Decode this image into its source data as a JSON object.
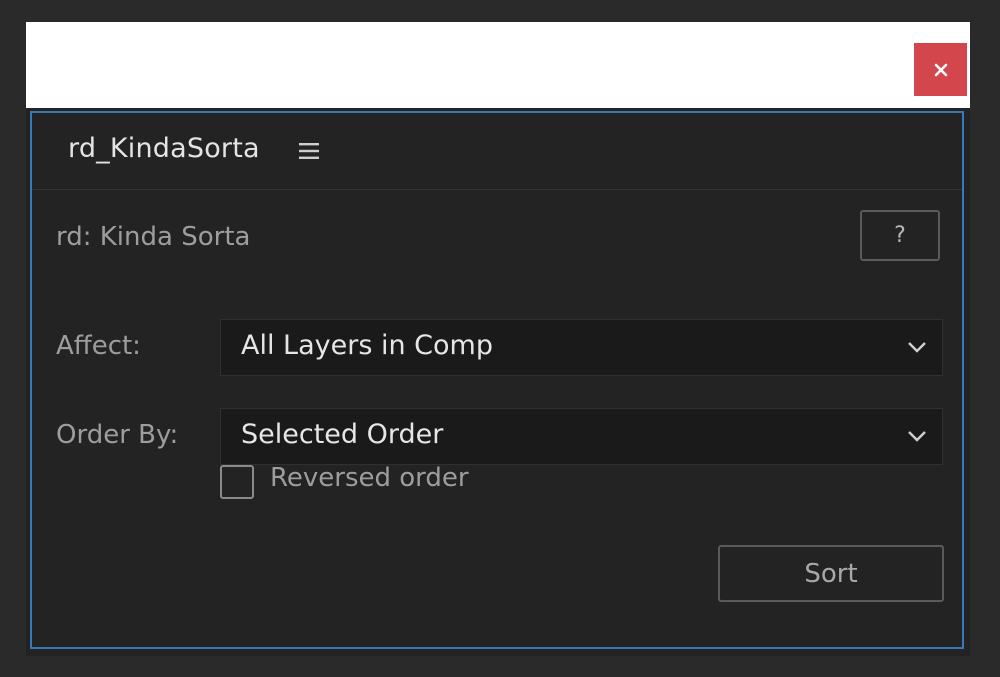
{
  "window": {
    "close_label": "×"
  },
  "panel": {
    "tab_title": "rd_KindaSorta",
    "menu_icon": "hamburger-menu-icon",
    "script_title": "rd: Kinda Sorta",
    "help_label": "?",
    "affect": {
      "label": "Affect:",
      "selected": "All Layers in Comp"
    },
    "order_by": {
      "label": "Order By:",
      "selected": "Selected Order"
    },
    "reversed": {
      "label": "Reversed order",
      "checked": false
    },
    "sort_label": "Sort"
  },
  "colors": {
    "background": "#2a2a2a",
    "panel_bg": "#232323",
    "panel_border": "#3b78b8",
    "close_button": "#d3464c",
    "dropdown_bg": "#1a1a1a"
  }
}
